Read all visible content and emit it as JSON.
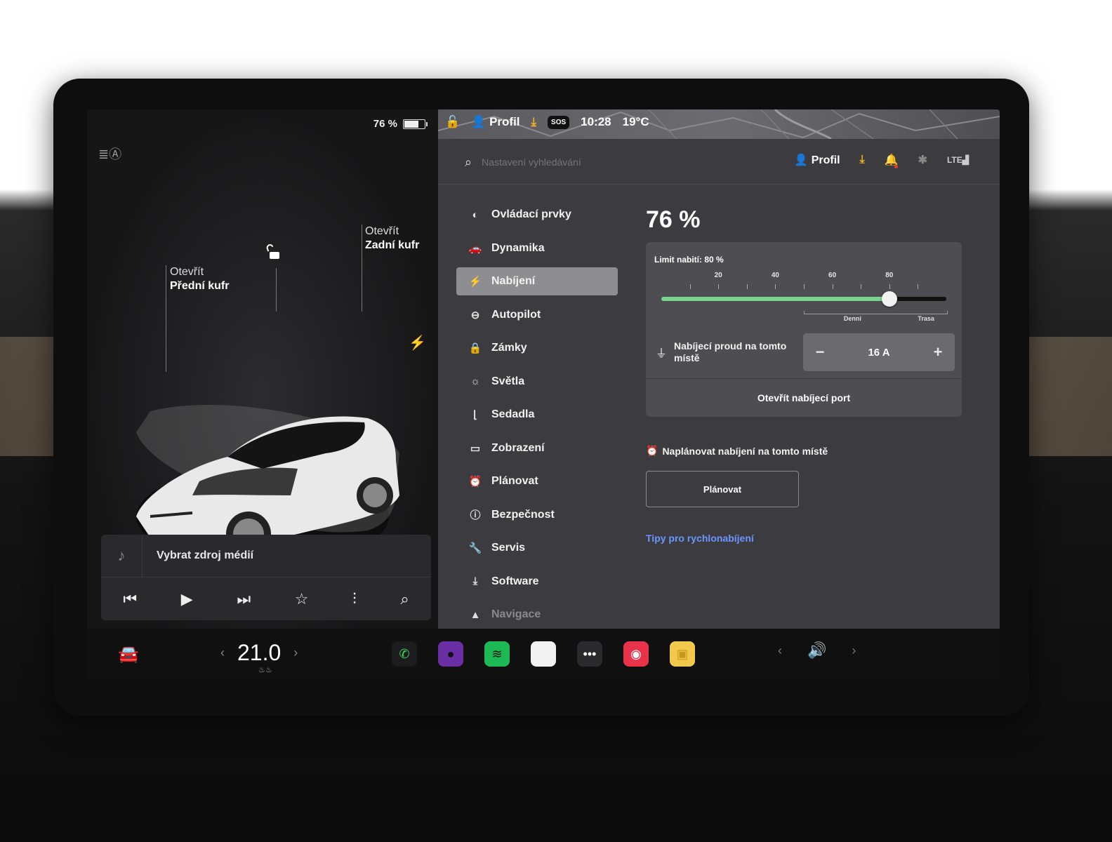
{
  "left_pane": {
    "battery_percent": "76 %",
    "battery_level": 0.76,
    "front_trunk": {
      "action": "Otevřít",
      "name": "Přední kufr"
    },
    "rear_trunk": {
      "action": "Otevřít",
      "name": "Zadní kufr"
    },
    "media": {
      "source_label": "Vybrat zdroj médií",
      "controls": [
        "previous-icon",
        "play-icon",
        "next-icon",
        "favorite-icon",
        "equalizer-icon",
        "search-icon"
      ]
    }
  },
  "top_status": {
    "profile": "Profil",
    "sos": "SOS",
    "time": "10:28",
    "temperature": "19°C"
  },
  "settings_header": {
    "search_placeholder": "Nastavení vyhledávání",
    "profile": "Profil"
  },
  "menu": {
    "items": [
      {
        "label": "Ovládací prvky",
        "icon": "toggle-icon"
      },
      {
        "label": "Dynamika",
        "icon": "car-icon"
      },
      {
        "label": "Nabíjení",
        "icon": "bolt-icon",
        "active": true
      },
      {
        "label": "Autopilot",
        "icon": "steering-wheel-icon"
      },
      {
        "label": "Zámky",
        "icon": "lock-icon"
      },
      {
        "label": "Světla",
        "icon": "sun-icon"
      },
      {
        "label": "Sedadla",
        "icon": "seat-icon"
      },
      {
        "label": "Zobrazení",
        "icon": "display-icon"
      },
      {
        "label": "Plánovat",
        "icon": "alarm-clock-icon"
      },
      {
        "label": "Bezpečnost",
        "icon": "info-circle-icon"
      },
      {
        "label": "Servis",
        "icon": "wrench-icon"
      },
      {
        "label": "Software",
        "icon": "download-icon"
      },
      {
        "label": "Navigace",
        "icon": "navigation-arrow-icon"
      }
    ]
  },
  "charging": {
    "percent": "76 %",
    "limit_label": "Limit nabití: 80 %",
    "limit_value": 80,
    "current_level": 76,
    "tick_labels": [
      "20",
      "40",
      "60",
      "80"
    ],
    "range_daily": "Denní",
    "range_trip": "Trasa",
    "current_label": "Nabíjecí proud na tomto místě",
    "current_value": "16 A",
    "minus": "−",
    "plus": "+",
    "open_port": "Otevřít nabíjecí port",
    "schedule_label": "Naplánovat nabíjení na tomto místě",
    "schedule_button": "Plánovat",
    "tips_link": "Tipy pro rychlonabíjení",
    "slider_fill_color": "#79d48f",
    "link_color": "#6c95ff"
  },
  "dock": {
    "temperature": "21.0",
    "apps": [
      {
        "name": "phone-app",
        "color": "#1c1c1e",
        "glyph": "✆",
        "glyph_color": "#3ddc5c"
      },
      {
        "name": "camera-app",
        "color": "#6b2fa5",
        "glyph": "●",
        "glyph_color": "#111"
      },
      {
        "name": "spotify-app",
        "color": "#1db954",
        "glyph": "≋",
        "glyph_color": "#111"
      },
      {
        "name": "notes-app",
        "color": "#f2f2f2",
        "glyph": "",
        "glyph_color": "#111"
      },
      {
        "name": "more-apps",
        "color": "#2a2a2c",
        "glyph": "•••",
        "glyph_color": "#fff"
      },
      {
        "name": "media-app",
        "color": "#e8334a",
        "glyph": "◉",
        "glyph_color": "#fff"
      },
      {
        "name": "toybox-app",
        "color": "#f2c94c",
        "glyph": "▣",
        "glyph_color": "#c59a1c"
      }
    ]
  }
}
